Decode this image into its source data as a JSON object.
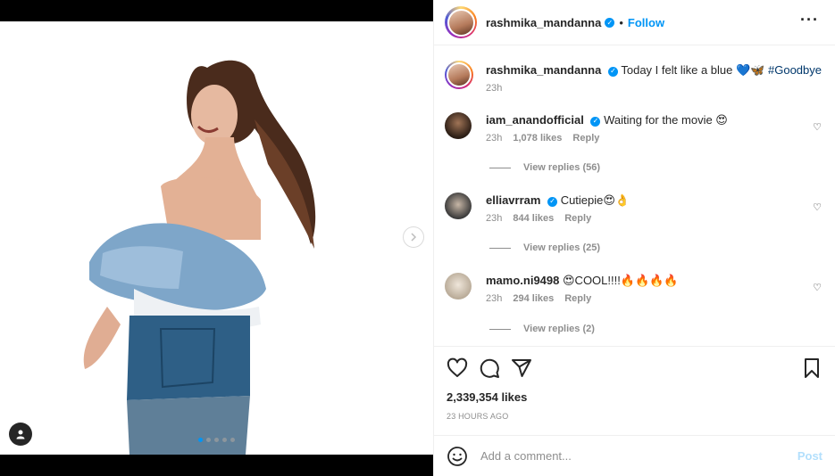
{
  "post": {
    "username": "rashmika_mandanna",
    "follow_label": "Follow",
    "separator": "•",
    "more_label": "···",
    "carousel": {
      "count": 5,
      "active_index": 0
    }
  },
  "caption": {
    "username": "rashmika_mandanna",
    "text": "Today I felt like a blue 💙🦋",
    "hashtag": "#Goodbye",
    "time": "23h"
  },
  "comments": [
    {
      "username": "iam_anandofficial",
      "verified": true,
      "text": "Waiting for the movie 😍",
      "time": "23h",
      "likes": "1,078 likes",
      "reply_label": "Reply",
      "view_replies": "View replies (56)"
    },
    {
      "username": "elliavrram",
      "verified": true,
      "text": "Cutiepie😍👌",
      "time": "23h",
      "likes": "844 likes",
      "reply_label": "Reply",
      "view_replies": "View replies (25)"
    },
    {
      "username": "mamo.ni9498",
      "verified": false,
      "text": "😍COOL!!!!🔥🔥🔥🔥",
      "time": "23h",
      "likes": "294 likes",
      "reply_label": "Reply",
      "view_replies": "View replies (2)"
    }
  ],
  "stats": {
    "likes": "2,339,354 likes",
    "time_ago": "23 HOURS AGO"
  },
  "add_comment": {
    "placeholder": "Add a comment...",
    "post_label": "Post"
  },
  "colors": {
    "accent": "#0095f6",
    "hashtag": "#00376b",
    "muted": "#8e8e8e"
  }
}
